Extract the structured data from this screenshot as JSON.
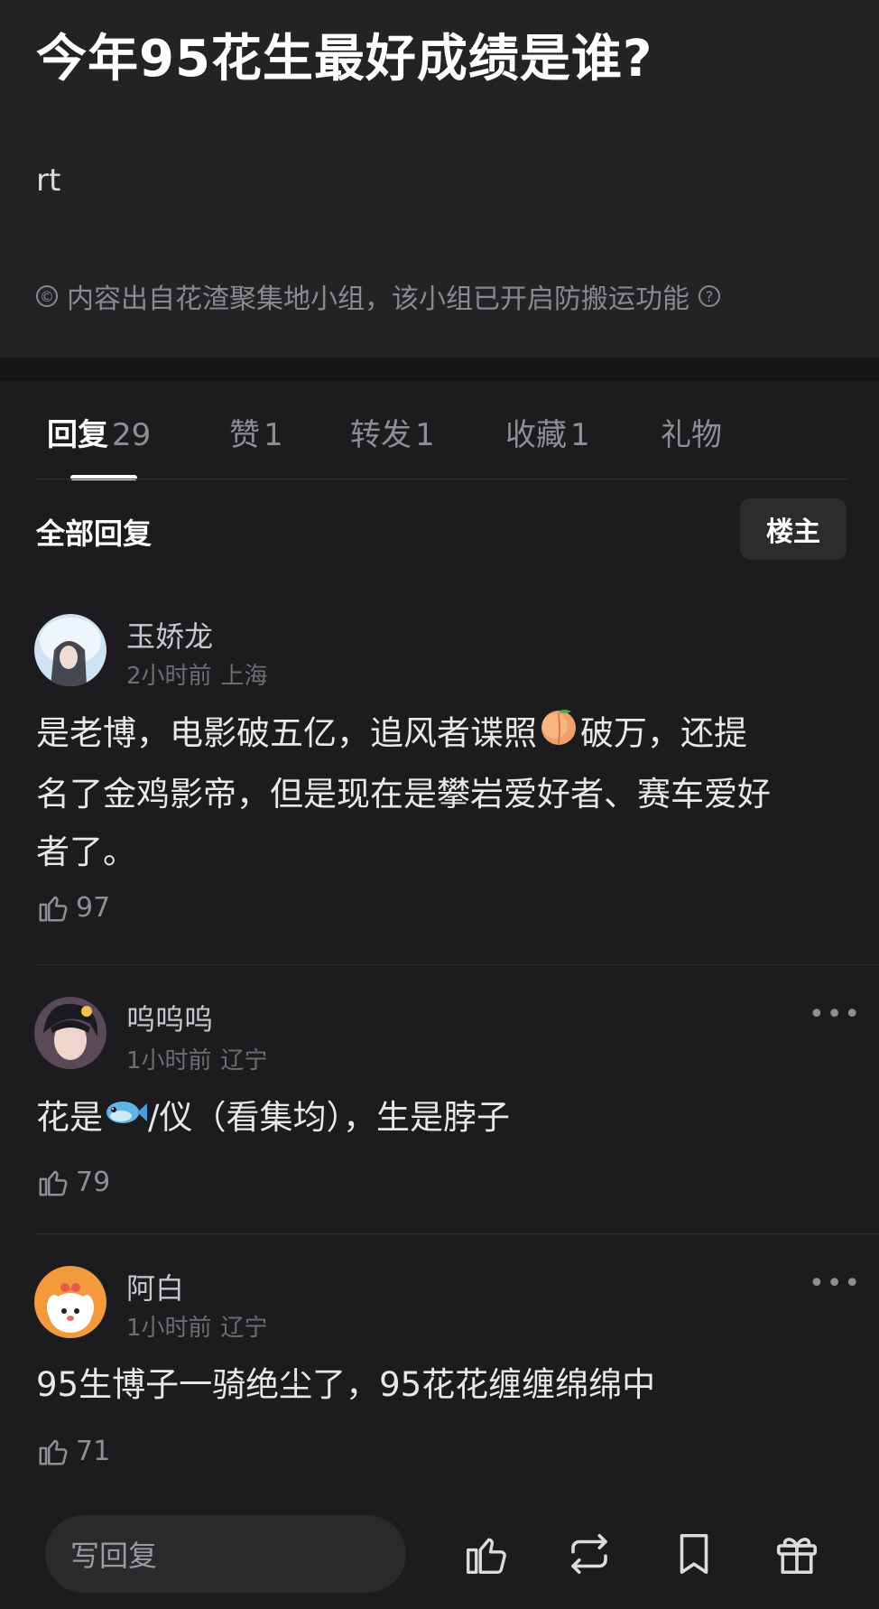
{
  "post": {
    "title": "今年95花生最好成绩是谁?",
    "body": "rt",
    "source_note": "内容出自花渣聚集地小组，该小组已开启防搬运功能",
    "source_icon": "copyright-icon",
    "help_icon": "question-circle-icon"
  },
  "tabs": [
    {
      "label": "回复",
      "count": "29",
      "active": true
    },
    {
      "label": "赞",
      "count": "1"
    },
    {
      "label": "转发",
      "count": "1"
    },
    {
      "label": "收藏",
      "count": "1"
    },
    {
      "label": "礼物",
      "count": ""
    }
  ],
  "replies_header": {
    "label": "全部回复",
    "op_filter": "楼主"
  },
  "replies": [
    {
      "username": "玉娇龙",
      "time": "2小时前",
      "location": "上海",
      "content_lines": [
        "是老博，电影破五亿，追风者谍照",
        "破万，还提",
        "名了金鸡影帝，但是现在是攀岩爱好者、赛车爱好",
        "者了。"
      ],
      "content_emoji": "peach-emoji",
      "likes": "97"
    },
    {
      "username": "呜呜呜",
      "time": "1小时前",
      "location": "辽宁",
      "content_before": "花是",
      "content_emoji": "fish-emoji",
      "content_after": "/仪（看集均），生是脖子",
      "likes": "79"
    },
    {
      "username": "阿白",
      "time": "1小时前",
      "location": "辽宁",
      "content": "95生博子一骑绝尘了，95花花缠缠绵绵中",
      "likes": "71"
    }
  ],
  "bottom_bar": {
    "placeholder": "写回复",
    "icons": [
      "like-icon",
      "repost-icon",
      "bookmark-icon",
      "gift-icon"
    ]
  },
  "colors": {
    "background": "#1c1c1e",
    "header_bg": "#232326",
    "text_primary": "#ffffff",
    "text_secondary": "#8e8e93"
  }
}
